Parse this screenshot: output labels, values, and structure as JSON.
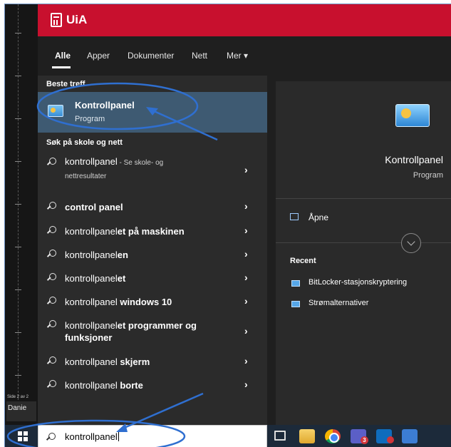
{
  "word": {
    "page_label": "Side 2 av 2",
    "user": "Danie"
  },
  "brand": {
    "name": "UiA",
    "color": "#c8102e"
  },
  "tabs": [
    {
      "label": "Alle",
      "active": true
    },
    {
      "label": "Apper"
    },
    {
      "label": "Dokumenter"
    },
    {
      "label": "Nett"
    },
    {
      "label": "Mer ▾"
    }
  ],
  "best_match": {
    "heading": "Beste treff",
    "title": "Kontrollpanel",
    "subtitle": "Program"
  },
  "web": {
    "heading": "Søk på skole og nett",
    "items": [
      {
        "pre": "kontrollpanel",
        "bold": "",
        "suffix": " - Se skole- og",
        "line2": "nettresultater"
      },
      {
        "pre": "",
        "bold": "control panel",
        "suffix": "",
        "line2": ""
      },
      {
        "pre": "kontrollpanel",
        "bold": "et på maskinen",
        "suffix": "",
        "line2": ""
      },
      {
        "pre": "kontrollpanel",
        "bold": "en",
        "suffix": "",
        "line2": ""
      },
      {
        "pre": "kontrollpanel",
        "bold": "et",
        "suffix": "",
        "line2": ""
      },
      {
        "pre": "kontrollpanel ",
        "bold": "windows 10",
        "suffix": "",
        "line2": ""
      },
      {
        "pre": "kontrollpanel",
        "bold": "et programmer og",
        "suffix": "",
        "line2": "funksjoner"
      },
      {
        "pre": "kontrollpanel ",
        "bold": "skjerm",
        "suffix": "",
        "line2": ""
      },
      {
        "pre": "kontrollpanel ",
        "bold": "borte",
        "suffix": "",
        "line2": ""
      }
    ]
  },
  "preview": {
    "title": "Kontrollpanel",
    "subtitle": "Program",
    "open_label": "Åpne",
    "recent_heading": "Recent",
    "recent": [
      "BitLocker-stasjonskryptering",
      "Strømalternativer"
    ]
  },
  "taskbar": {
    "search_value": "kontrollpanel",
    "teams_badge": "3"
  },
  "icons": {
    "start": "windows-logo-icon",
    "search": "search-icon",
    "taskview": "task-view-icon",
    "explorer": "file-explorer-icon",
    "chrome": "chrome-icon",
    "teams": "teams-icon",
    "outlook": "outlook-icon"
  }
}
